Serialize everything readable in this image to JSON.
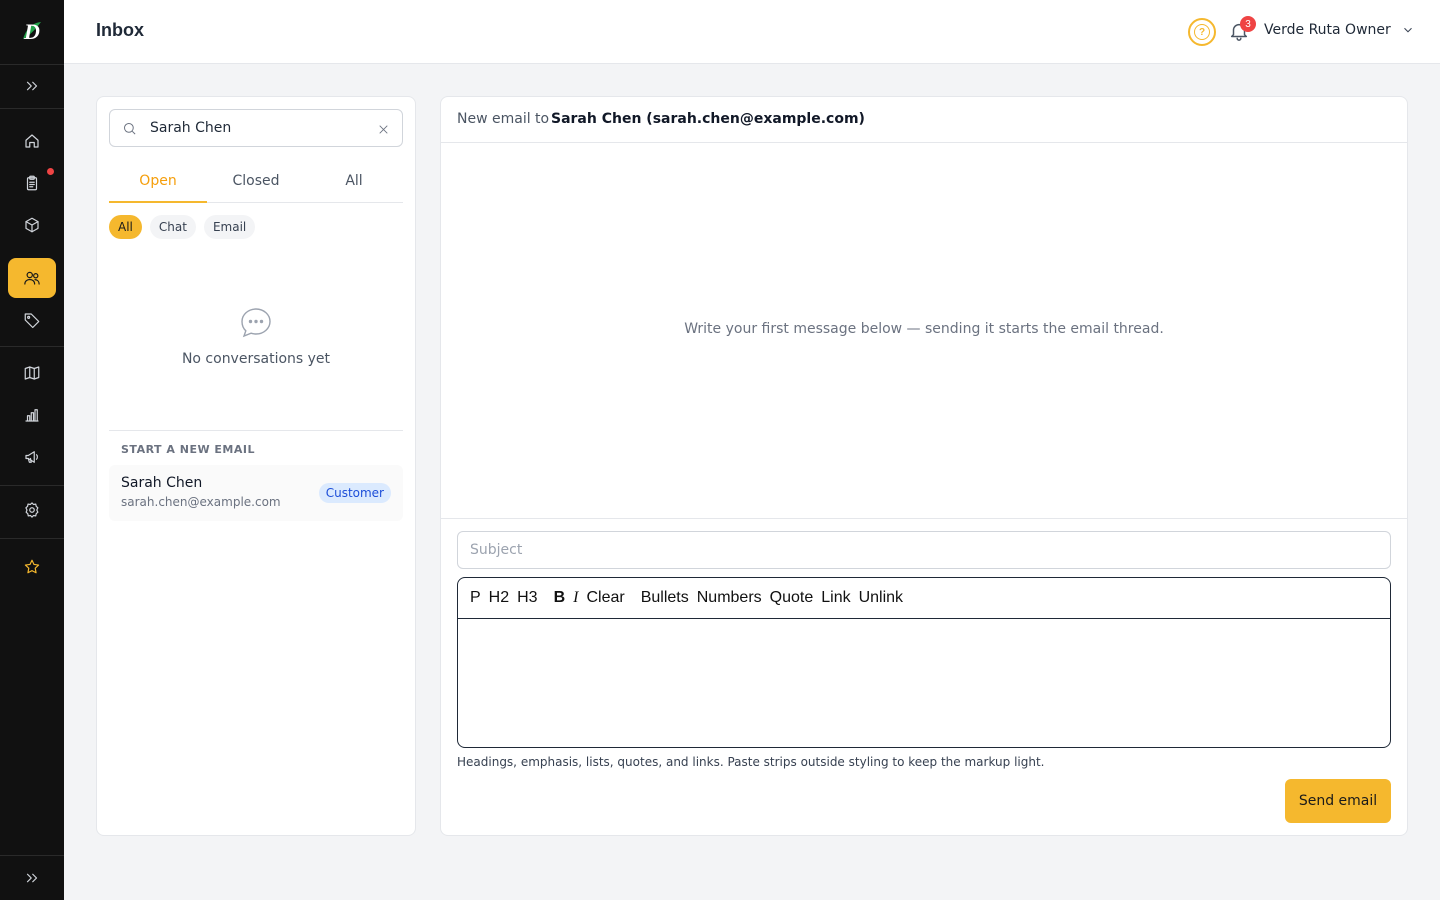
{
  "app": {
    "logo_letter": "D"
  },
  "header": {
    "title": "Inbox",
    "help_symbol": "?",
    "notification_count": "3",
    "user_name": "Verde Ruta Owner"
  },
  "sidebar": {
    "items": [
      {
        "icon": "home-icon"
      },
      {
        "icon": "clipboard-icon",
        "has_dot": true
      },
      {
        "icon": "box-icon"
      },
      {
        "icon": "users-icon",
        "active": true
      },
      {
        "icon": "tag-icon"
      },
      {
        "icon": "map-icon"
      },
      {
        "icon": "bar-chart-icon"
      },
      {
        "icon": "megaphone-icon"
      },
      {
        "icon": "gear-icon"
      },
      {
        "icon": "star-icon"
      }
    ]
  },
  "conversations": {
    "search": {
      "value": "Sarah Chen"
    },
    "tabs": [
      {
        "label": "Open",
        "active": true
      },
      {
        "label": "Closed"
      },
      {
        "label": "All"
      }
    ],
    "filters": [
      {
        "label": "All",
        "active": true
      },
      {
        "label": "Chat"
      },
      {
        "label": "Email"
      }
    ],
    "empty_text": "No conversations yet",
    "new_email": {
      "heading": "START A NEW EMAIL",
      "contact": {
        "name": "Sarah Chen",
        "email": "sarah.chen@example.com",
        "badge": "Customer"
      }
    }
  },
  "compose": {
    "to_label": "New email to",
    "to_value": "Sarah Chen (sarah.chen@example.com)",
    "thread_hint": "Write your first message below — sending it starts the email thread.",
    "subject_placeholder": "Subject",
    "toolbar": {
      "p": "P",
      "h2": "H2",
      "h3": "H3",
      "bold": "B",
      "italic": "I",
      "clear": "Clear",
      "bullets": "Bullets",
      "numbers": "Numbers",
      "quote": "Quote",
      "link": "Link",
      "unlink": "Unlink"
    },
    "helper_text": "Headings, emphasis, lists, quotes, and links. Paste strips outside styling to keep the markup light.",
    "send_label": "Send email"
  },
  "colors": {
    "accent": "#f5b82e",
    "sidebar_bg": "#111111",
    "badge_red": "#ef4444",
    "customer_badge_bg": "#dbeafe",
    "customer_badge_text": "#1d4ed8"
  }
}
